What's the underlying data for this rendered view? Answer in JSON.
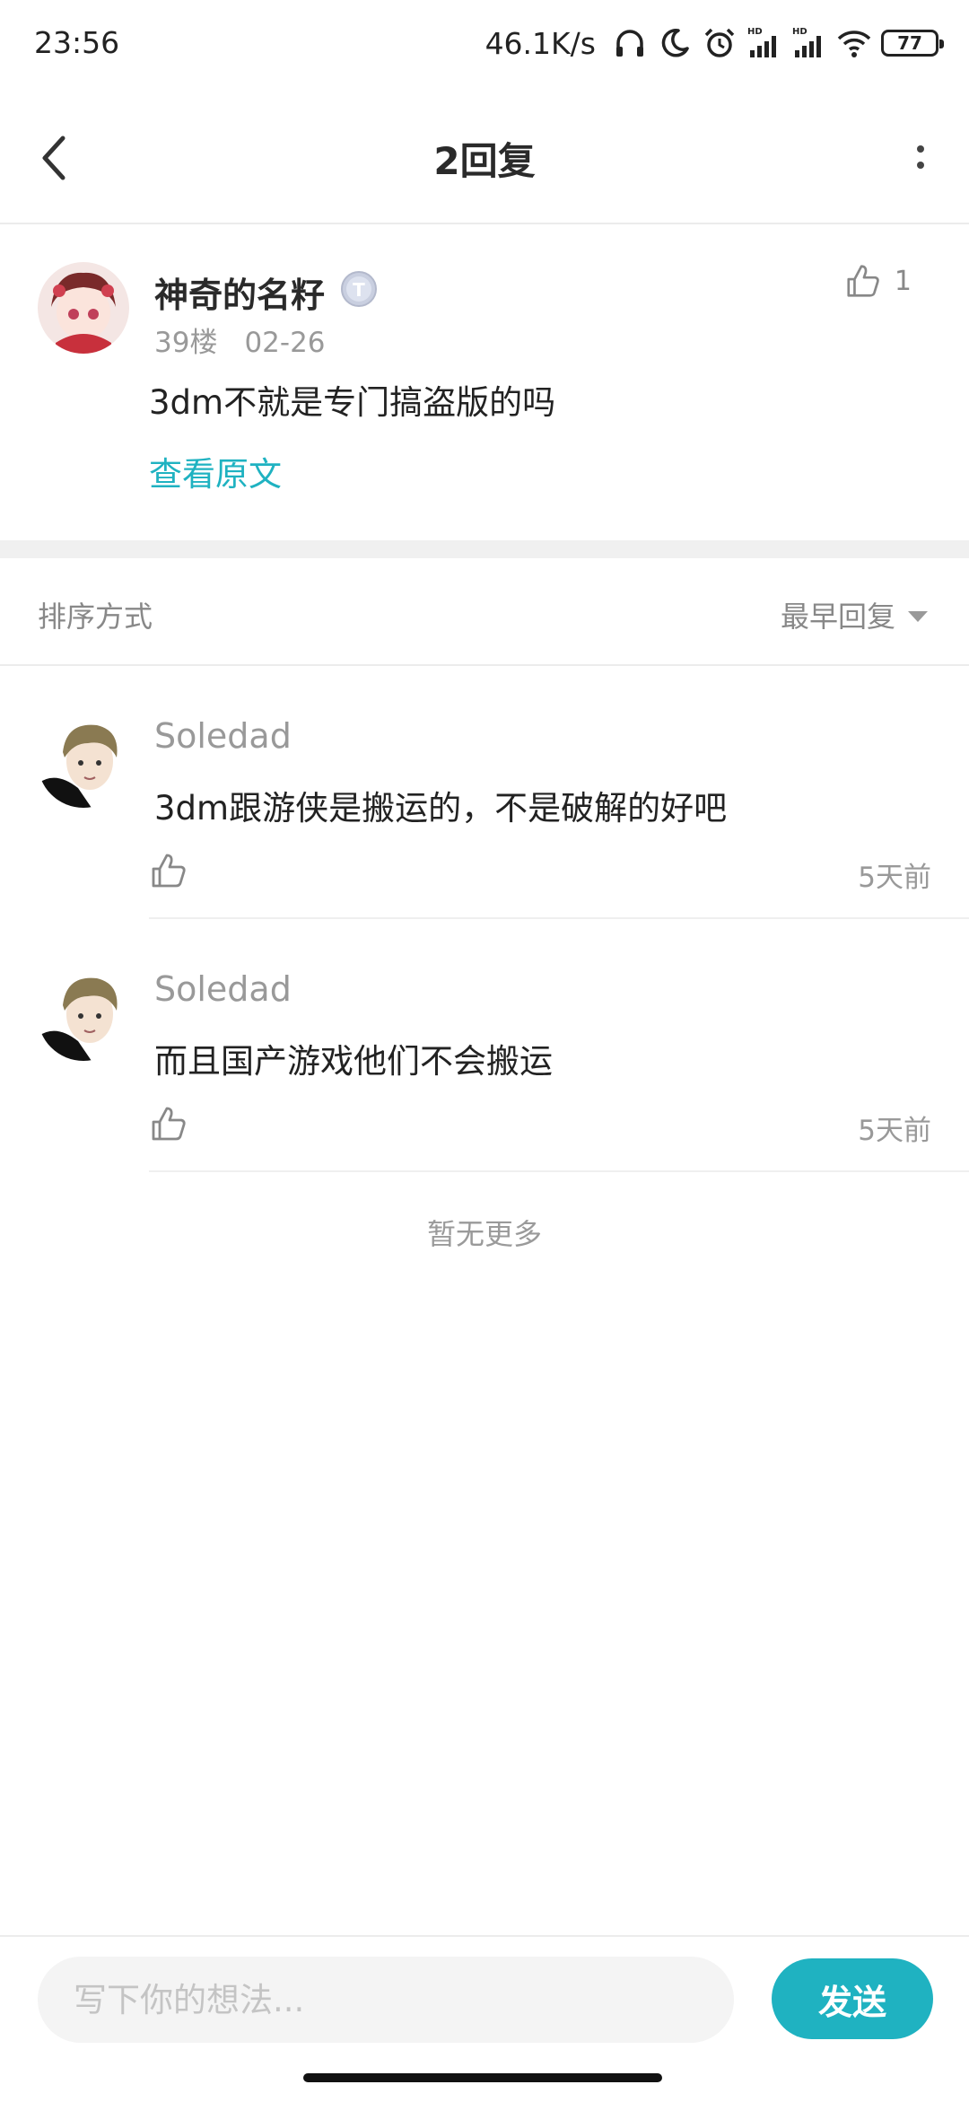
{
  "status_bar": {
    "time": "23:56",
    "net_speed": "46.1K/s",
    "battery": "77",
    "icons": [
      "headphones-icon",
      "moon-icon",
      "alarm-icon",
      "signal-hd-icon",
      "signal-hd-icon",
      "wifi-icon",
      "battery-icon"
    ]
  },
  "header": {
    "title": "2回复",
    "back_icon": "chevron-left-icon",
    "more_icon": "more-vertical-icon"
  },
  "main_comment": {
    "author": "神奇的名籽",
    "badge_letter": "T",
    "floor": "39楼",
    "date": "02-26",
    "text": "3dm不就是专门搞盗版的吗",
    "view_original": "查看原文",
    "like_count": "1"
  },
  "sort": {
    "label": "排序方式",
    "selected": "最早回复"
  },
  "replies": [
    {
      "author": "Soledad",
      "text": "3dm跟游侠是搬运的，不是破解的好吧",
      "time": "5天前"
    },
    {
      "author": "Soledad",
      "text": "而且国产游戏他们不会搬运",
      "time": "5天前"
    }
  ],
  "footer_note": "暂无更多",
  "composer": {
    "placeholder": "写下你的想法...",
    "send_label": "发送"
  },
  "colors": {
    "accent": "#1fb2c1",
    "muted_text": "#999999",
    "band": "#f0f0f0"
  }
}
